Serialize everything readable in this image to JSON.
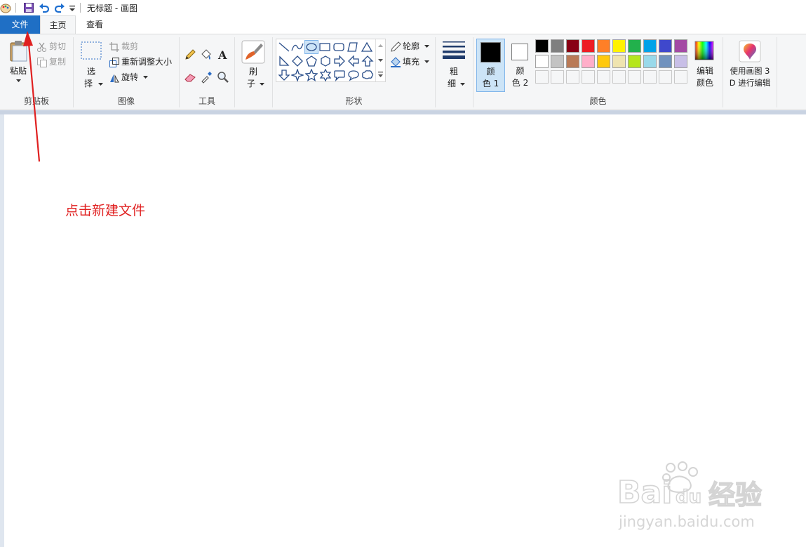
{
  "titlebar": {
    "title": "无标题 - 画图",
    "icons": [
      "paint-app-icon",
      "save-icon",
      "undo-icon",
      "redo-icon",
      "customize-dropdown-icon"
    ]
  },
  "tabs": [
    {
      "label": "文件"
    },
    {
      "label": "主页"
    },
    {
      "label": "查看"
    }
  ],
  "clipboard": {
    "paste": "粘贴",
    "cut": "剪切",
    "copy": "复制",
    "label": "剪贴板"
  },
  "image": {
    "select_1": "选",
    "select_2": "择",
    "crop": "裁剪",
    "resize": "重新调整大小",
    "rotate": "旋转",
    "label": "图像"
  },
  "tools": {
    "label": "工具",
    "icons": [
      "pencil-icon",
      "fill-bucket-icon",
      "text-icon",
      "eraser-icon",
      "color-picker-icon",
      "magnifier-icon"
    ]
  },
  "brushes": {
    "label_1": "刷",
    "label_2": "子"
  },
  "shapes": {
    "outline": "轮廓",
    "fill": "填充",
    "label": "形状"
  },
  "size": {
    "label_1": "粗",
    "label_2": "细"
  },
  "colors": {
    "color1_a": "颜",
    "color1_b": "色 1",
    "color2_a": "颜",
    "color2_b": "色 2",
    "edit_a": "编辑",
    "edit_b": "颜色",
    "label": "颜色",
    "color1_value": "#000000",
    "color2_value": "#ffffff",
    "palette_row1": [
      "#000000",
      "#7f7f7f",
      "#880015",
      "#ed1c24",
      "#ff7f27",
      "#fff200",
      "#22b14c",
      "#00a2e8",
      "#3f48cc",
      "#a349a4"
    ],
    "palette_row2": [
      "#ffffff",
      "#c3c3c3",
      "#b97a57",
      "#ffaec9",
      "#ffc90e",
      "#efe4b0",
      "#b5e61d",
      "#99d9ea",
      "#7092be",
      "#c8bfe7"
    ]
  },
  "paint3d": {
    "line1": "使用画图 3",
    "line2": "D 进行编辑"
  },
  "annotation": {
    "text": "点击新建文件",
    "color": "#e02020"
  },
  "watermark": {
    "brand": "Bai",
    "brand2": "du",
    "cn": "经验",
    "url": "jingyan.baidu.com"
  }
}
